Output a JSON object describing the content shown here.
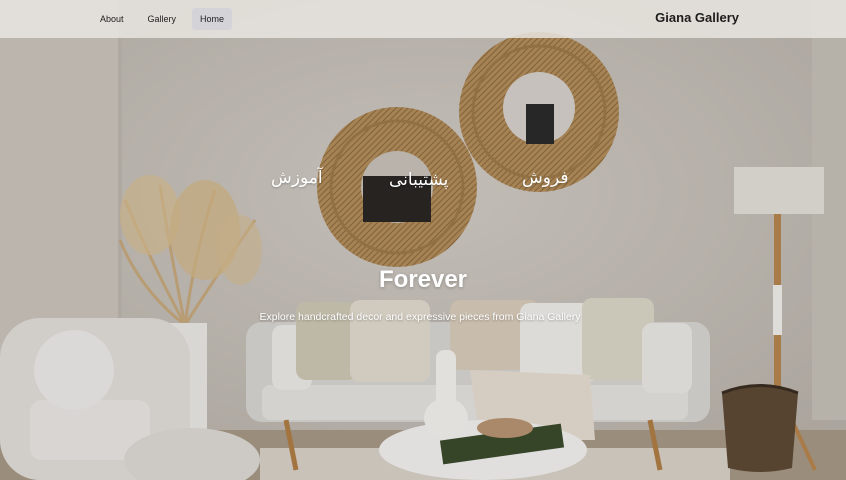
{
  "nav": {
    "links": [
      {
        "label": "About"
      },
      {
        "label": "Gallery"
      },
      {
        "label": "Home",
        "active": true
      }
    ],
    "brand": "Giana Gallery"
  },
  "hero": {
    "menu": [
      "فروش",
      "پشتیبانی",
      "آموزش"
    ],
    "title": "Forever",
    "subtitle": "Explore handcrafted decor and expressive pieces from Giana Gallery"
  },
  "colors": {
    "nav_bg": "#e8e4e0",
    "active_tab": "#d4d4d8",
    "hero_text": "#ffffff"
  }
}
